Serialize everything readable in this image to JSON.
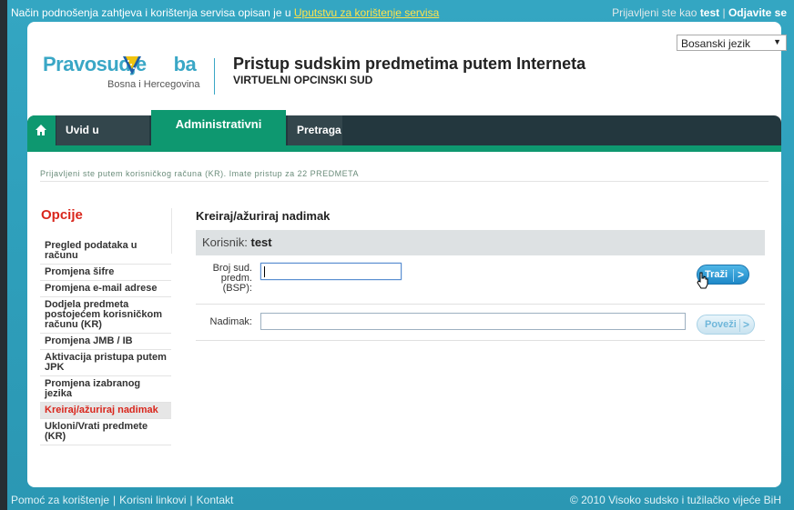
{
  "topbar": {
    "notice_prefix": "Način podnošenja zahtjeva i korištenja servisa opisan je u",
    "notice_link": "Uputstvu za korištenje servisa",
    "logged_in_as_label": "Prijavljeni ste kao",
    "username": "test",
    "separator": "|",
    "logout_label": "Odjavite se"
  },
  "header": {
    "brand_prefix": "Pravosudje",
    "brand_suffix": "ba",
    "brand_region": "Bosna i Hercegovina",
    "title": "Pristup sudskim predmetima putem Interneta",
    "subtitle": "VIRTUELNI OPCINSKI SUD",
    "language_selected": "Bosanski jezik"
  },
  "nav": {
    "tabs": [
      {
        "label": "Uvid u predmet"
      },
      {
        "label": "Administrativni panel"
      },
      {
        "label": "Pretraga"
      }
    ],
    "active_tab": "Administrativni panel"
  },
  "info_line": "Prijavljeni ste putem korisničkog računa (KR). Imate pristup za 22 PREDMETA",
  "sidebar": {
    "title": "Opcije",
    "items": [
      {
        "label": "Pregled podataka u računu"
      },
      {
        "label": "Promjena šifre"
      },
      {
        "label": "Promjena e-mail adrese"
      },
      {
        "label": "Dodjela predmeta postojećem korisničkom računu (KR)"
      },
      {
        "label": "Promjena JMB / IB"
      },
      {
        "label": "Aktivacija pristupa putem JPK"
      },
      {
        "label": "Promjena izabranog jezika"
      },
      {
        "label": "Kreiraj/ažuriraj nadimak"
      },
      {
        "label": "Ukloni/Vrati predmete (KR)"
      }
    ]
  },
  "main": {
    "title": "Kreiraj/ažuriraj nadimak",
    "user_label": "Korisnik:",
    "user_value": "test",
    "bsp_label": "Broj sud. predm. (BSP):",
    "bsp_value": "",
    "search_button": "Traži",
    "nickname_label": "Nadimak:",
    "nickname_value": "",
    "link_button": "Poveži"
  },
  "footer": {
    "links": [
      "Pomoć za korištenje",
      "Korisni linkovi",
      "Kontakt"
    ],
    "copyright": "© 2010 Visoko sudsko i tužilačko vijeće BiH"
  },
  "colors": {
    "accent": "#3aa7c6",
    "nav_dark": "#23373e",
    "nav_green": "#0e9870",
    "sidebar_active": "#d9261c"
  }
}
